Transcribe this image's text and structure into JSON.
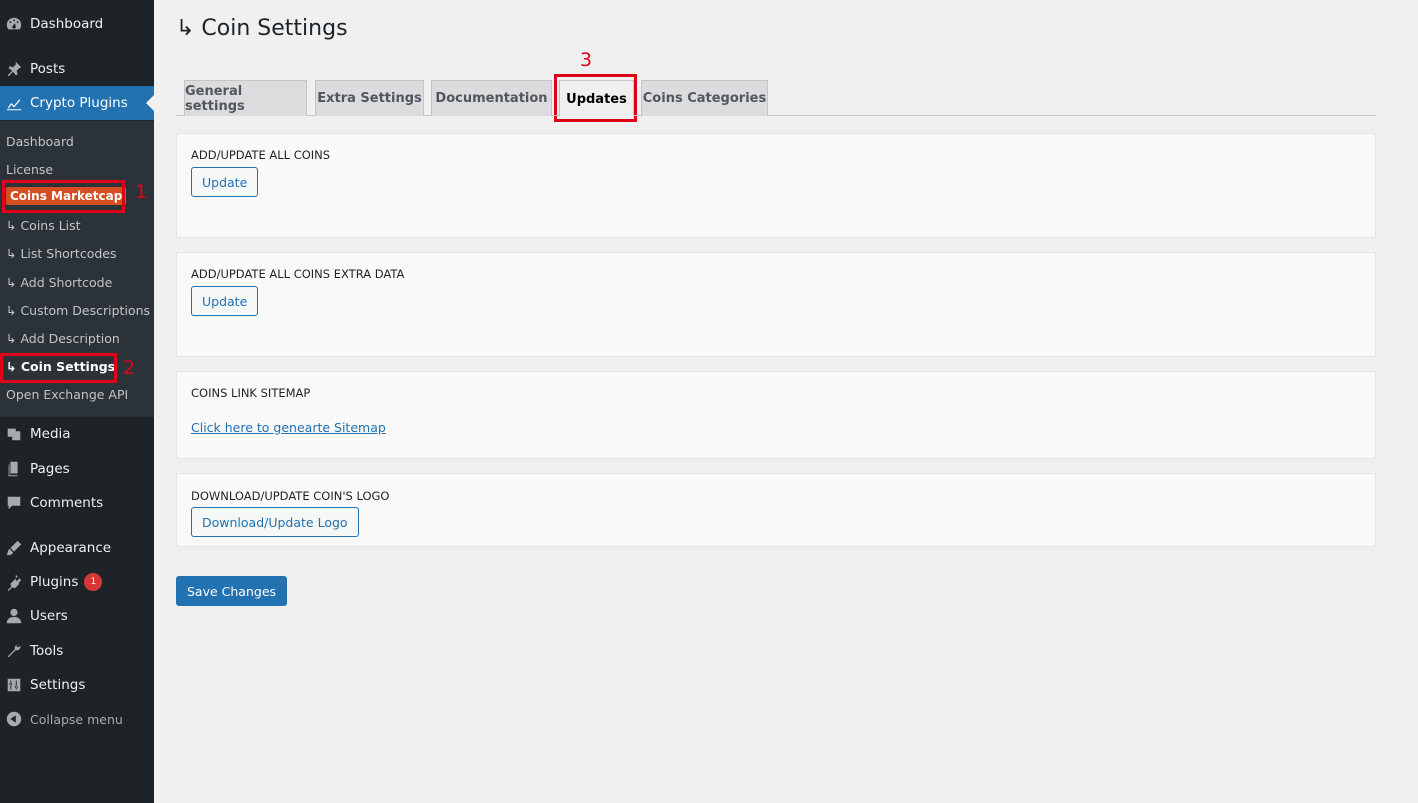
{
  "sidebar": {
    "top_items": [
      {
        "label": "Dashboard",
        "icon": "dashboard-icon"
      },
      {
        "label": "Posts",
        "icon": "pin-icon"
      },
      {
        "label": "Crypto Plugins",
        "icon": "chart-icon"
      }
    ],
    "submenu": [
      {
        "label": "Dashboard"
      },
      {
        "label": "License"
      },
      {
        "label": "Coins Marketcap"
      },
      {
        "label": "↳ Coins List"
      },
      {
        "label": "↳ List Shortcodes"
      },
      {
        "label": "↳ Add Shortcode"
      },
      {
        "label": "↳ Custom Descriptions"
      },
      {
        "label": "↳ Add Description"
      },
      {
        "label": "↳ Coin Settings"
      },
      {
        "label": "Open Exchange API"
      }
    ],
    "bottom_items": [
      {
        "label": "Media",
        "icon": "media-icon"
      },
      {
        "label": "Pages",
        "icon": "pages-icon"
      },
      {
        "label": "Comments",
        "icon": "comments-icon"
      },
      {
        "label": "Appearance",
        "icon": "brush-icon"
      },
      {
        "label": "Plugins",
        "icon": "plugin-icon",
        "badge": "1"
      },
      {
        "label": "Users",
        "icon": "user-icon"
      },
      {
        "label": "Tools",
        "icon": "wrench-icon"
      },
      {
        "label": "Settings",
        "icon": "settings-icon"
      }
    ],
    "collapse_label": "Collapse menu"
  },
  "annotations": {
    "one": "1",
    "two": "2",
    "three": "3"
  },
  "page": {
    "title": "↳ Coin Settings"
  },
  "tabs": [
    {
      "label": "General settings"
    },
    {
      "label": "Extra Settings"
    },
    {
      "label": "Documentation"
    },
    {
      "label": "Updates"
    },
    {
      "label": "Coins Categories"
    }
  ],
  "sections": {
    "all_coins": {
      "title": "ADD/UPDATE ALL COINS",
      "button": "Update"
    },
    "extra_data": {
      "title": "ADD/UPDATE ALL COINS EXTRA DATA",
      "button": "Update"
    },
    "sitemap": {
      "title": "COINS LINK SITEMAP",
      "link": "Click here to genearte Sitemap"
    },
    "logo": {
      "title": "DOWNLOAD/UPDATE COIN'S LOGO",
      "button": "Download/Update Logo"
    }
  },
  "save_label": "Save Changes",
  "colors": {
    "sidebar_bg": "#1d2327",
    "submenu_bg": "#2c3338",
    "accent": "#2271b1",
    "highlight": "#d54e21",
    "annotation": "#e1001a"
  }
}
